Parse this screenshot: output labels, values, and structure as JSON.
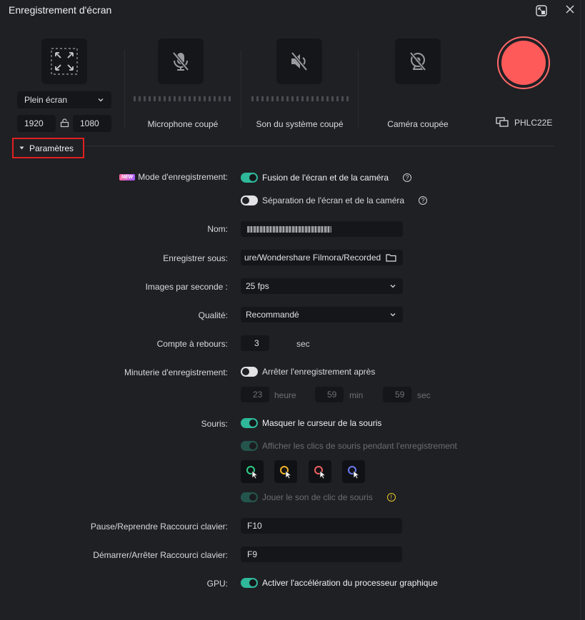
{
  "window": {
    "title": "Enregistrement d'écran"
  },
  "colors": {
    "accent": "#2fb89a",
    "record": "#ff5a5a",
    "highlight": "#e02020"
  },
  "top": {
    "mode_select": "Plein écran",
    "width": "1920",
    "height": "1080",
    "mic_label": "Microphone coupé",
    "system_label": "Son du système coupé",
    "camera_label": "Caméra coupée",
    "monitor_label": "PHLC22E"
  },
  "settings": {
    "header": "Paramètres",
    "record_mode_badge": "NEW",
    "record_mode_label": "Mode d'enregistrement:",
    "record_mode_opt1": "Fusion de l'écran et de la caméra",
    "record_mode_opt2": "Séparation de l'écran et de la caméra",
    "name_label": "Nom:",
    "save_label": "Enregistrer sous:",
    "save_path": "ure/Wondershare Filmora/Recorded",
    "fps_label": "Images par seconde :",
    "fps_value": "25 fps",
    "quality_label": "Qualité:",
    "quality_value": "Recommandé",
    "countdown_label": "Compte à rebours:",
    "countdown_value": "3",
    "countdown_unit": "sec",
    "timer_label": "Minuterie d'enregistrement:",
    "timer_opt": "Arrêter l'enregistrement après",
    "timer_hours": "23",
    "timer_hours_unit": "heure",
    "timer_minutes": "59",
    "timer_minutes_unit": "min",
    "timer_seconds": "59",
    "timer_seconds_unit": "sec",
    "mouse_label": "Souris:",
    "mouse_opt1": "Masquer le curseur de la souris",
    "mouse_opt2": "Afficher les clics de souris pendant l'enregistrement",
    "mouse_opt3": "Jouer le son de clic de souris",
    "pause_label": "Pause/Reprendre Raccourci clavier:",
    "pause_value": "F10",
    "start_label": "Démarrer/Arrêter Raccourci clavier:",
    "start_value": "F9",
    "gpu_label": "GPU:",
    "gpu_opt": "Activer l'accélération du processeur graphique"
  },
  "icons": [
    "fullscreen-icon",
    "mic-muted-icon",
    "speaker-muted-icon",
    "camera-off-icon",
    "record-icon",
    "monitor-icon",
    "chevron-down-icon",
    "folder-icon",
    "link-icon",
    "help-icon",
    "warning-icon",
    "cursor-click-icon"
  ]
}
